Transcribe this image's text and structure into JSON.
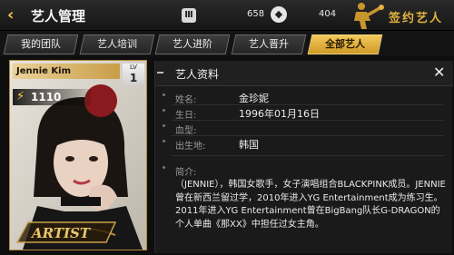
{
  "header": {
    "back_glyph": "‹",
    "title": "艺人管理",
    "menu_glyph": "Ⅲ",
    "count1": "658",
    "gem_glyph": "◆",
    "count2": "404",
    "sign_label": "签约艺人"
  },
  "tabs": [
    {
      "label": "我的团队",
      "active": false
    },
    {
      "label": "艺人培训",
      "active": false
    },
    {
      "label": "艺人进阶",
      "active": false
    },
    {
      "label": "艺人晋升",
      "active": false
    },
    {
      "label": "全部艺人",
      "active": true
    }
  ],
  "card": {
    "name": "Jennie Kim",
    "lv_label": "LV",
    "lv_value": "1",
    "power": "1110",
    "logo_text": "ARTIST"
  },
  "panel": {
    "title": "艺人资料",
    "close_glyph": "✕",
    "rows": [
      {
        "label": "姓名:",
        "value": "金珍妮"
      },
      {
        "label": "生日:",
        "value": "1996年01月16日"
      },
      {
        "label": "血型:",
        "value": ""
      },
      {
        "label": "出生地:",
        "value": "韩国"
      }
    ],
    "bio_label": "简介:",
    "bio": "（JENNIE），韩国女歌手，女子演唱组合BLACKPINK成员。JENNIE曾在新西兰留过学，2010年进入YG Entertainment成为练习生。2011年进入YG Entertainment曾在BigBang队长G-DRAGON的个人单曲《那XX》中担任过女主角。"
  },
  "colors": {
    "accent_gold": "#e2b33f",
    "tab_active": "#f3c85a",
    "background": "#0e0e0e"
  },
  "icons": [
    "back-arrow-icon",
    "menu-icon",
    "diamond-icon",
    "sign-artist-icon",
    "close-icon",
    "lightning-icon"
  ]
}
